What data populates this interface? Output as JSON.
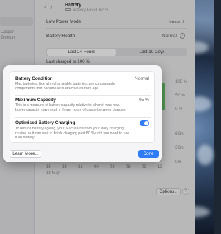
{
  "sidebar": {
    "fragments": [
      "Jasper",
      "Demon"
    ]
  },
  "header": {
    "back_icon": "chevron-left-icon",
    "forward_icon": "chevron-right-icon",
    "title": "Battery",
    "subtitle": "Battery Level: 87 %"
  },
  "settings": {
    "low_power_mode_label": "Low Power Mode",
    "low_power_mode_value": "Never",
    "battery_health_label": "Battery Health",
    "battery_health_value": "Normal",
    "tabs": [
      "Last 24 Hours",
      "Last 10 Days"
    ],
    "last_charged": "Last charged to 100 %",
    "pct_labels": [
      "100 %",
      "50 %",
      "0 %"
    ],
    "time_labels": [
      "60m",
      "30m",
      "0m"
    ],
    "axis_labels": [
      "15",
      "18",
      "21",
      "00",
      "03",
      "06",
      "09",
      "12"
    ],
    "date_label": "18 May",
    "options_label": "Options...",
    "help_label": "?"
  },
  "modal": {
    "condition_title": "Battery Condition",
    "condition_value": "Normal",
    "condition_desc": "Mac batteries, like all rechargeable batteries, are consumable components that become less effective as they age.",
    "capacity_title": "Maximum Capacity",
    "capacity_value": "95 %",
    "capacity_desc": "This is a measure of battery capacity relative to when it was new. Lower capacity may result in fewer hours of usage between charges.",
    "optimised_title": "Optimised Battery Charging",
    "optimised_enabled": true,
    "optimised_desc": "To reduce battery ageing, your Mac learns from your daily charging routine so it can wait to finish charging past 80 % until you need to use it on battery.",
    "learn_more_label": "Learn More...",
    "done_label": "Done"
  },
  "colors": {
    "accent": "#2f7cf6",
    "chart_green": "#6cc46c"
  }
}
